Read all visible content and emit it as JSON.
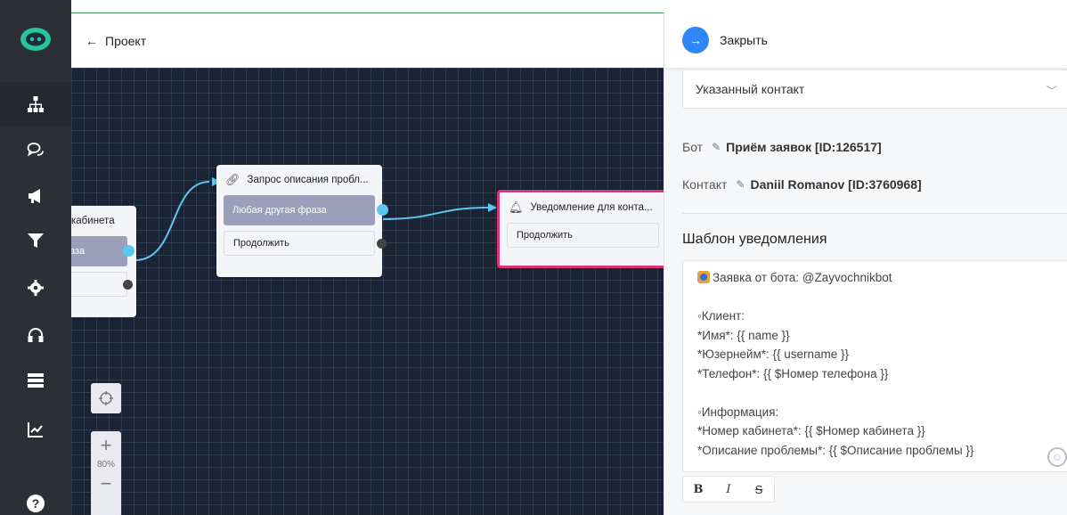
{
  "header": {
    "back_label": "Проект"
  },
  "sidebar": {
    "items": [
      {
        "icon": "sitemap-icon",
        "active": true
      },
      {
        "icon": "chat-icon"
      },
      {
        "icon": "megaphone-icon"
      },
      {
        "icon": "filter-icon"
      },
      {
        "icon": "gear-icon"
      },
      {
        "icon": "headset-icon"
      },
      {
        "icon": "database-icon"
      },
      {
        "icon": "chart-line-icon"
      },
      {
        "icon": "help-icon"
      }
    ]
  },
  "canvas": {
    "zoom_level": "80%",
    "nodes": [
      {
        "title": "кабинета",
        "buttons": [
          "аза",
          ""
        ]
      },
      {
        "title": "Запрос описания пробл...",
        "buttons": [
          "Любая другая фраза",
          "Продолжить"
        ]
      },
      {
        "title": "Уведомление для конта...",
        "buttons": [
          "Продолжить"
        ]
      }
    ]
  },
  "panel": {
    "close_label": "Закрыть",
    "recipient_select": "Указанный контакт",
    "bot_label": "Бот",
    "bot_value": "Приём заявок [ID:126517]",
    "contact_label": "Контакт",
    "contact_value": "Daniil Romanov [ID:3760968]",
    "template_title": "Шаблон уведомления",
    "template_lines": [
      "Заявка от бота: @Zayvochnikbot",
      "",
      "◦Клиент:",
      "*Имя*: {{ name }}",
      "*Юзернейм*: {{ username }}",
      "*Телефон*: {{ $Номер телефона }}",
      "",
      "◦Информация:",
      "*Номер кабинета*: {{ $Номер кабинета }}",
      "*Описание проблемы*: {{ $Описание проблемы }}"
    ],
    "format": {
      "bold": "B",
      "italic": "I",
      "strike": "S"
    }
  },
  "colors": {
    "accent": "#2f86f6",
    "sidebar_bg": "#2c2f36",
    "canvas_bg": "#1b2435",
    "selected_node": "#e0327a",
    "link": "#5ec7f0"
  }
}
